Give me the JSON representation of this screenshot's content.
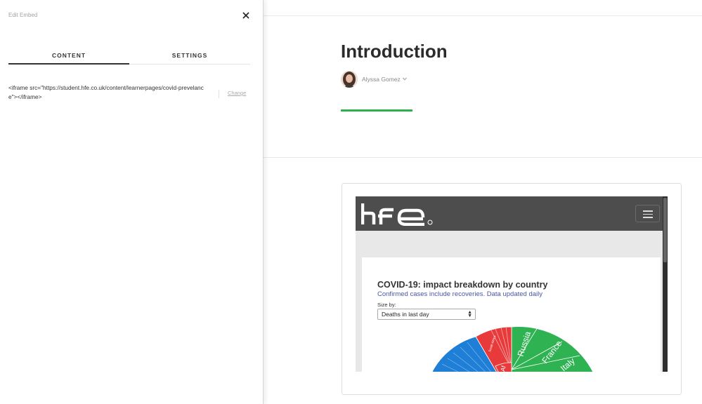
{
  "panel": {
    "title": "Edit Embed",
    "tabs": [
      {
        "label": "CONTENT"
      },
      {
        "label": "SETTINGS"
      }
    ],
    "active_tab": "CONTENT",
    "embed_code": "<iframe src=\"https://student.hfe.co.uk/content/learnerpages/covid-prevelance\"></iframe>",
    "change_label": "Change"
  },
  "page": {
    "title": "Introduction",
    "author": "Alyssa Gomez",
    "accent_color": "#2bb24c"
  },
  "embed": {
    "logo_text": "hfe",
    "chart_title": "COVID-19: impact breakdown by country",
    "chart_subtitle": "Confirmed cases include recoveries. Data updated daily",
    "size_label": "Size by:",
    "size_selected": "Deaths in last day",
    "segment_labels": {
      "russia": "Russia",
      "france": "France",
      "italy": "Italy",
      "south_africa": "South Africa",
      "africa_partial": "Af"
    },
    "colors": {
      "europe": "#2fb352",
      "americas": "#1f7fd6",
      "africa": "#e83a3a"
    }
  }
}
